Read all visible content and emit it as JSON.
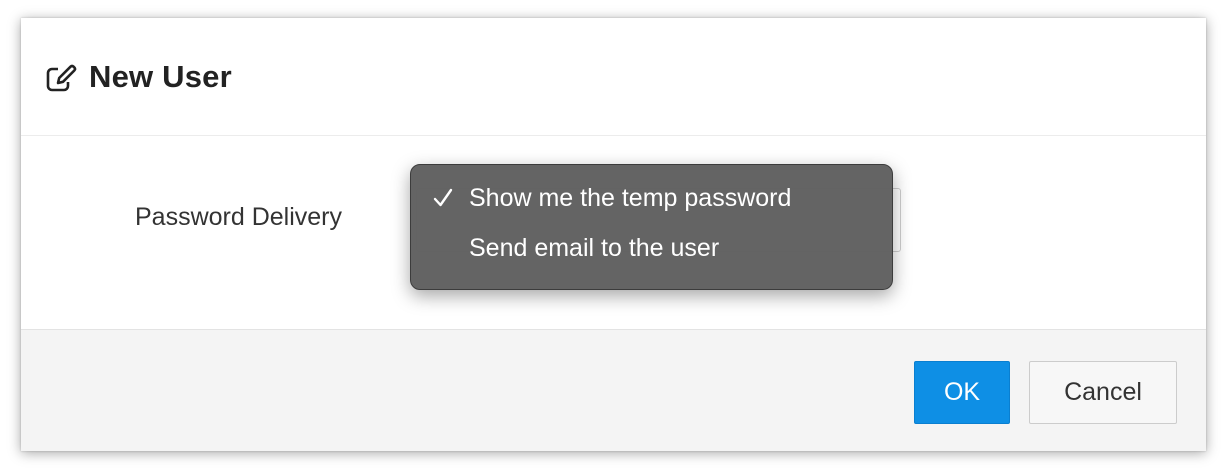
{
  "dialog": {
    "title": "New User",
    "title_icon": "edit-icon"
  },
  "form": {
    "password_delivery_label": "Password Delivery",
    "password_delivery_options": [
      {
        "label": "Show me the temp password",
        "selected": true
      },
      {
        "label": "Send email to the user",
        "selected": false
      }
    ],
    "check_icon": "checkmark-icon"
  },
  "footer": {
    "ok_label": "OK",
    "cancel_label": "Cancel"
  },
  "colors": {
    "primary_button": "#0e8fe5",
    "menu_background": "#5f5f5f",
    "footer_background": "#f4f4f4"
  }
}
